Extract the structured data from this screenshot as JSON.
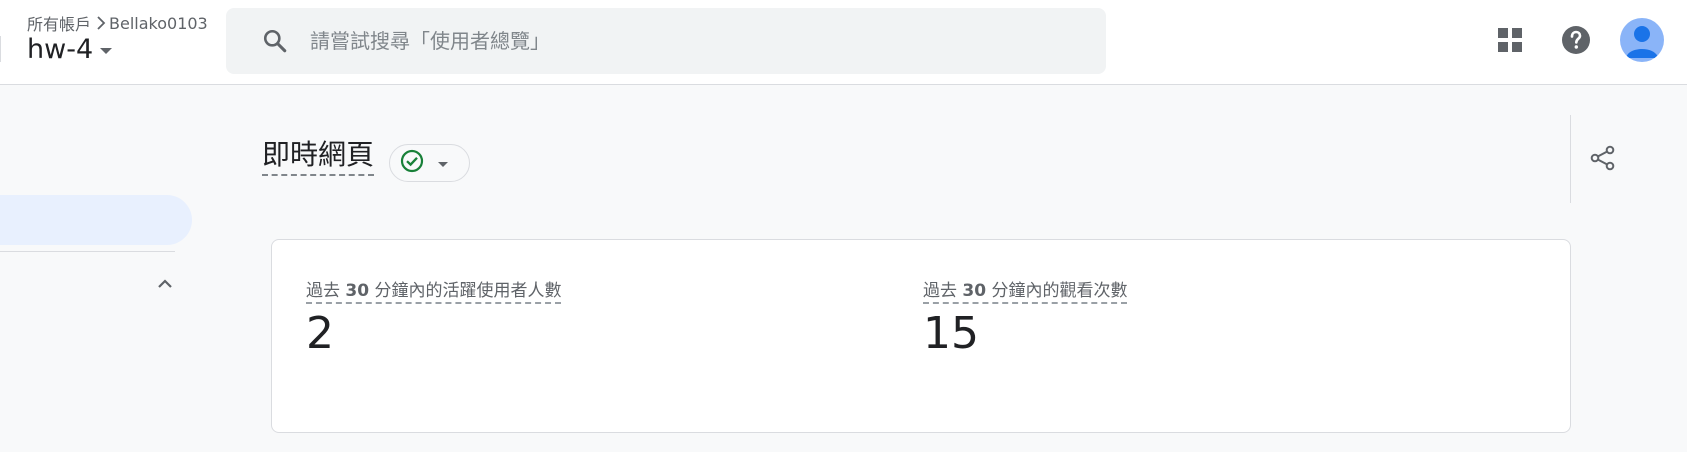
{
  "header": {
    "breadcrumb_all": "所有帳戶",
    "breadcrumb_account": "Bellako0103",
    "property_name": "hw-4",
    "search_placeholder": "請嘗試搜尋「使用者總覽」"
  },
  "icons": {
    "search": "search-icon",
    "apps": "apps-grid-icon",
    "help": "help-icon",
    "avatar": "account-avatar",
    "status": "check-circle-icon",
    "share": "share-icon",
    "collapse": "chevron-up-icon"
  },
  "page": {
    "title": "即時網頁"
  },
  "metrics": [
    {
      "label_pre": "過去 ",
      "label_num": "30",
      "label_post": " 分鐘內的活躍使用者人數",
      "value": "2"
    },
    {
      "label_pre": "過去 ",
      "label_num": "30",
      "label_post": " 分鐘內的觀看次數",
      "value": "15"
    }
  ],
  "colors": {
    "status_green": "#188038",
    "nav_active_bg": "#e8f0fe",
    "avatar_bg": "#8ab4f8",
    "avatar_fg": "#1a73e8"
  }
}
